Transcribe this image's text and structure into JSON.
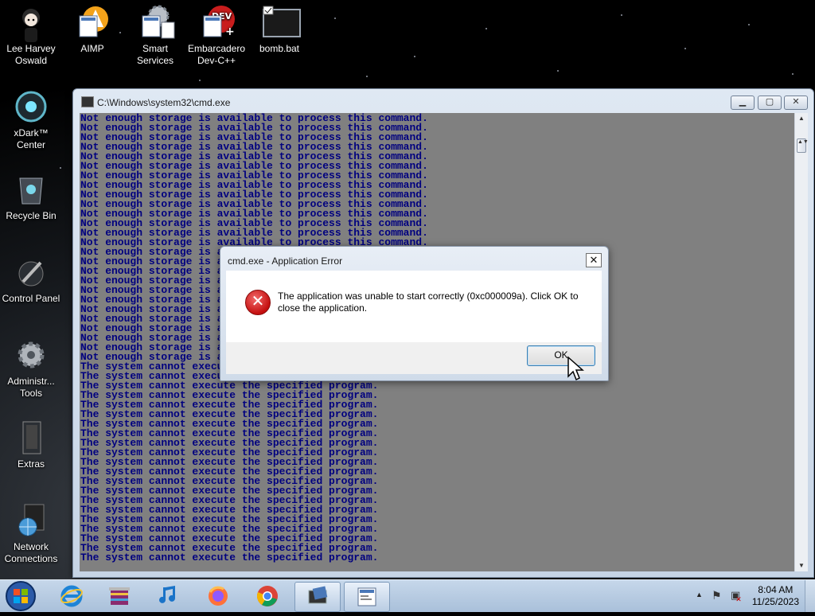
{
  "desktop": {
    "icons": [
      {
        "label": "Lee Harvey Oswald"
      },
      {
        "label": "AIMP"
      },
      {
        "label": "Smart Services"
      },
      {
        "label": "Embarcadero Dev-C++"
      },
      {
        "label": "bomb.bat"
      },
      {
        "label": "xDark™ Center"
      },
      {
        "label": "Recycle Bin"
      },
      {
        "label": "Control Panel"
      },
      {
        "label": "Administr... Tools"
      },
      {
        "label": "Extras"
      },
      {
        "label": "Network Connections"
      }
    ]
  },
  "cmd_window": {
    "title": "C:\\Windows\\system32\\cmd.exe",
    "minimize_label": "▁",
    "maximize_label": "▢",
    "close_label": "✕",
    "storage_line": "Not enough storage is available to process this command.",
    "storage_line_count": 26,
    "exec_line": "The system cannot execute the specified program.",
    "exec_line_count": 21,
    "text_color": "#00007f",
    "background_color": "#808080"
  },
  "dialog": {
    "title": "cmd.exe - Application Error",
    "close_label": "✕",
    "message": "The application was unable to start correctly (0xc000009a). Click OK to close the application.",
    "ok_label": "OK",
    "icon": "error-icon"
  },
  "taskbar": {
    "items": [
      {
        "name": "start-orb"
      },
      {
        "name": "internet-explorer-icon"
      },
      {
        "name": "winrar-icon"
      },
      {
        "name": "music-note-icon"
      },
      {
        "name": "firefox-icon"
      },
      {
        "name": "chrome-icon"
      },
      {
        "name": "cmd-task-icon",
        "active": true
      },
      {
        "name": "app-window-task-icon"
      }
    ],
    "clock_time": "8:04 AM",
    "clock_date": "11/25/2023"
  }
}
